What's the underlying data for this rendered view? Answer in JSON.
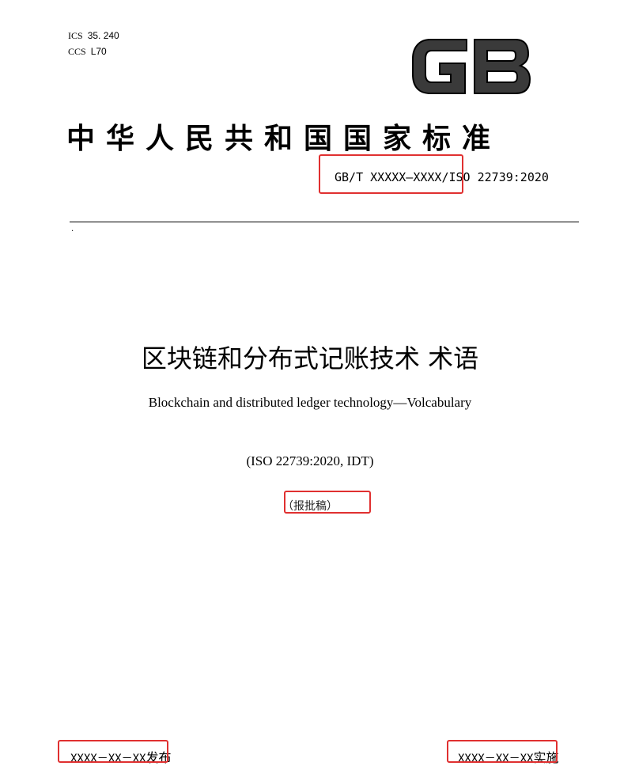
{
  "classification": {
    "ics_label": "ICS",
    "ics_code": "35. 240",
    "ccs_label": "CCS",
    "ccs_code": "L70"
  },
  "logo": {
    "text": "GB",
    "icon": "gb-logo"
  },
  "standard": {
    "title": "中华人民共和国国家标准",
    "number": "GB/T XXXXX—XXXX/ISO 22739:2020"
  },
  "document": {
    "title_cn": "区块链和分布式记账技术 术语",
    "title_en": "Blockchain and distributed ledger technology—Volcabulary",
    "iso_reference": "(ISO 22739:2020, IDT)",
    "draft_status": "（报批稿）"
  },
  "dates": {
    "issue_date": "XXXX－XX－XX",
    "issue_label": "发布",
    "implementation_date": "XXXX－XX－XX",
    "implementation_label": "实施"
  },
  "colors": {
    "highlight_box": "#e03030",
    "text": "#000000"
  }
}
